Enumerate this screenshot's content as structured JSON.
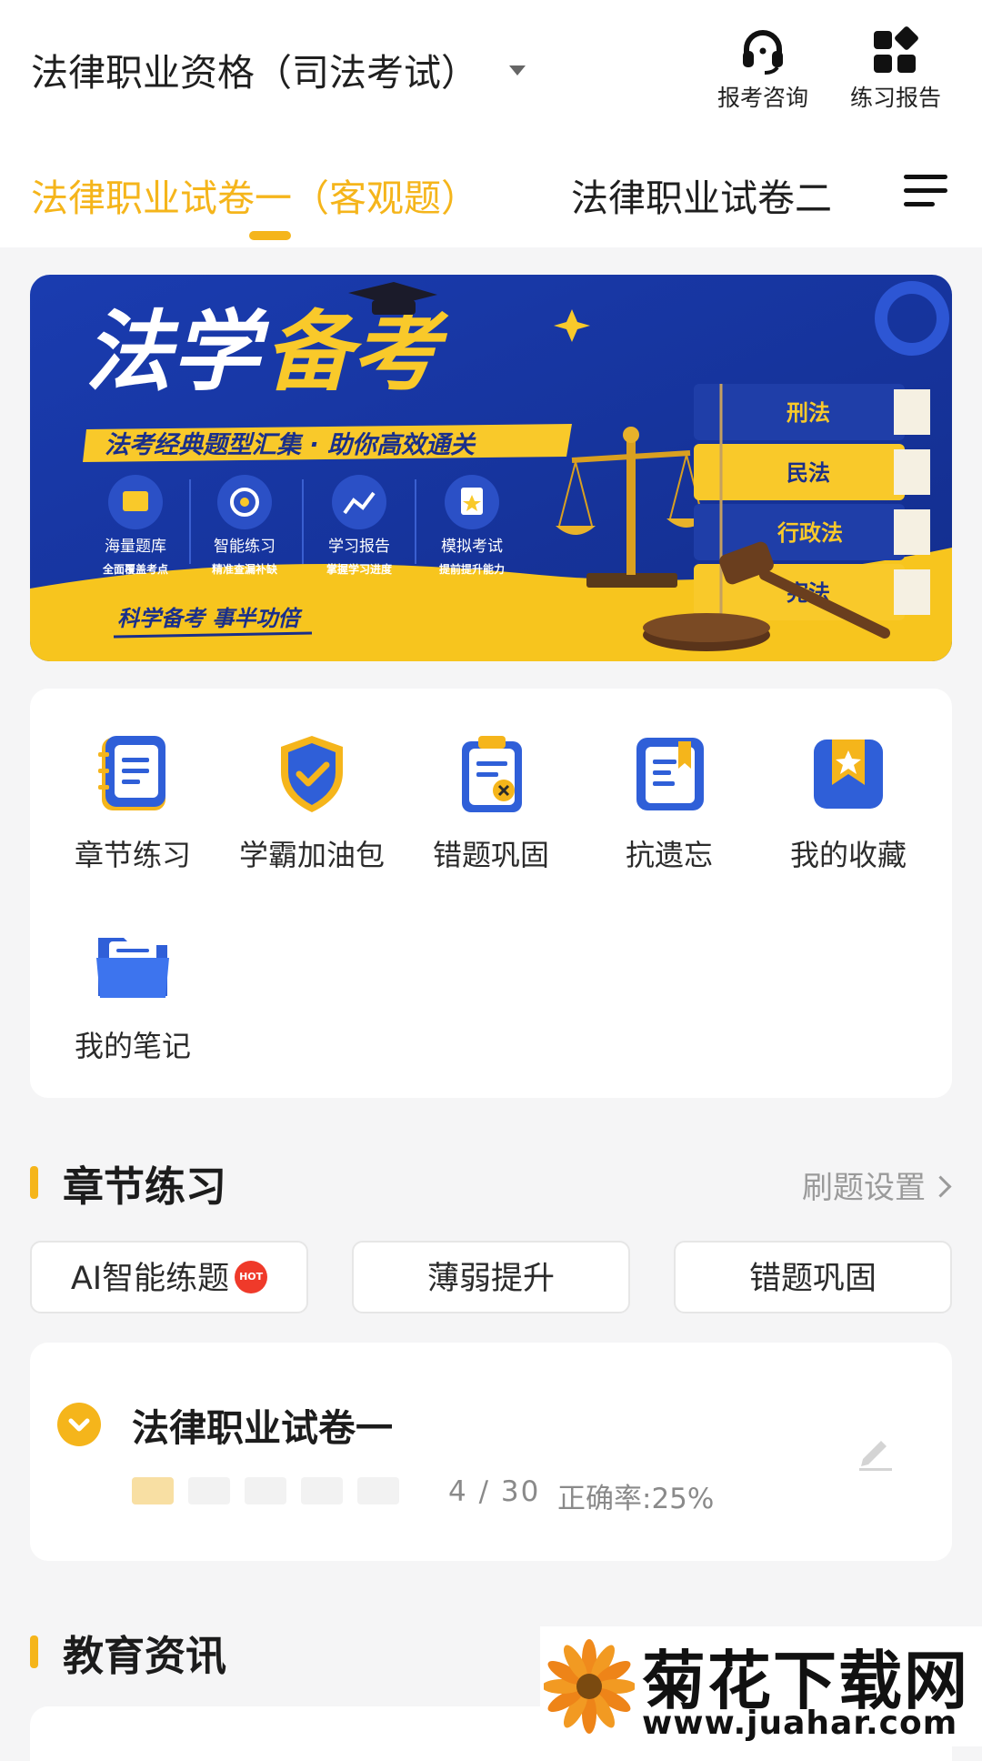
{
  "header": {
    "exam_title": "法律职业资格（司法考试）",
    "actions": [
      {
        "label": "报考咨询",
        "icon": "headset-icon"
      },
      {
        "label": "练习报告",
        "icon": "grid-report-icon"
      }
    ]
  },
  "tabs": [
    {
      "label": "法律职业试卷一（客观题）",
      "active": true
    },
    {
      "label": "法律职业试卷二",
      "active": false
    }
  ],
  "banner": {
    "title_part1": "法学",
    "title_part2": "备考",
    "subtitle": "法考经典题型汇集 · 助你高效通关",
    "features": [
      {
        "title": "海量题库",
        "desc": "全面覆盖考点",
        "icon": "question-bank-icon"
      },
      {
        "title": "智能练习",
        "desc": "精准查漏补缺",
        "icon": "target-icon"
      },
      {
        "title": "学习报告",
        "desc": "掌握学习进度",
        "icon": "chart-icon"
      },
      {
        "title": "模拟考试",
        "desc": "提前提升能力",
        "icon": "bookmark-star-icon"
      }
    ],
    "slogan": "科学备考  事半功倍",
    "books": [
      "刑法",
      "民法",
      "行政法",
      "宪法"
    ]
  },
  "quick_menu": [
    {
      "label": "章节练习",
      "icon": "notebook-icon"
    },
    {
      "label": "学霸加油包",
      "icon": "shield-check-icon"
    },
    {
      "label": "错题巩固",
      "icon": "clipboard-x-icon"
    },
    {
      "label": "抗遗忘",
      "icon": "document-bookmark-icon"
    },
    {
      "label": "我的收藏",
      "icon": "star-bookmark-icon"
    },
    {
      "label": "我的笔记",
      "icon": "folder-icon"
    }
  ],
  "chapter_section": {
    "title": "章节练习",
    "settings_link": "刷题设置",
    "modes": [
      {
        "label": "AI智能练题",
        "badge": "HOT"
      },
      {
        "label": "薄弱提升"
      },
      {
        "label": "错题巩固"
      }
    ],
    "paper": {
      "title": "法律职业试卷一",
      "progress": "4 / 30",
      "accuracy": "正确率:25%",
      "progress_fraction": 0.133
    }
  },
  "news_section": {
    "title": "教育资讯"
  },
  "watermark": {
    "name": "菊花下载网",
    "url": "www.juahar.com"
  },
  "colors": {
    "accent": "#f5b51b",
    "banner_blue": "#1d3aa6",
    "banner_yellow": "#f7c51e",
    "icon_blue": "#2f5fd8"
  }
}
